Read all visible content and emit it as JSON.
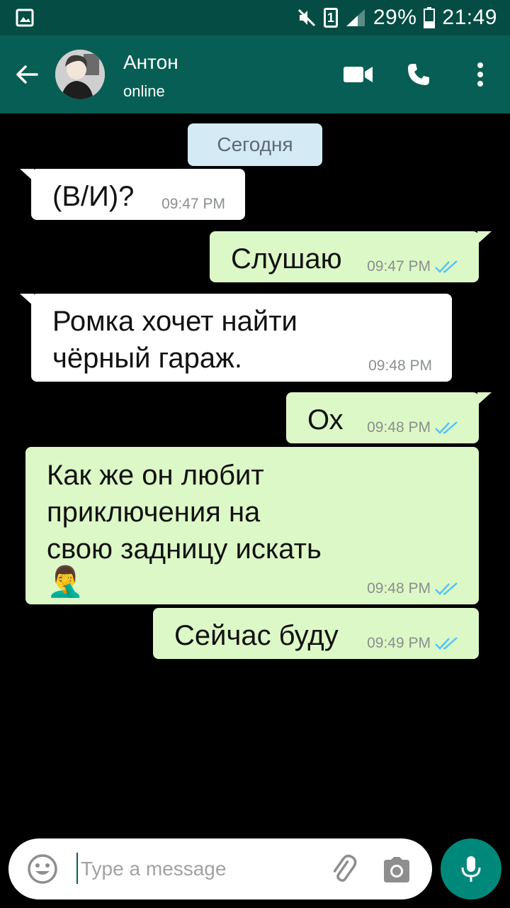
{
  "status_bar": {
    "battery": "29%",
    "time": "21:49",
    "sim_slot": "1",
    "icons": [
      "gallery-icon",
      "mute-icon",
      "sim-icon",
      "signal-icon",
      "battery-icon"
    ]
  },
  "header": {
    "contact_name": "Антон",
    "status": "online",
    "icons": [
      "back-arrow-icon",
      "video-call-icon",
      "phone-icon",
      "more-vert-icon"
    ]
  },
  "chat": {
    "date_label": "Сегодня",
    "messages": [
      {
        "dir": "in",
        "text": "(В/И)?",
        "time": "09:47 PM"
      },
      {
        "dir": "out",
        "text": "Слушаю",
        "time": "09:47 PM",
        "ticks": "read"
      },
      {
        "dir": "in",
        "text": "Ромка хочет найти\nчёрный гараж.",
        "time": "09:48 PM"
      },
      {
        "dir": "out",
        "text": "Ох",
        "time": "09:48 PM",
        "ticks": "read"
      },
      {
        "dir": "out",
        "text": "Как же он любит\nприключения на\nсвою задницу искать",
        "emoji": "🤦‍♂️",
        "time": "09:48 PM",
        "ticks": "read"
      },
      {
        "dir": "out",
        "text": "Сейчас буду",
        "time": "09:49 PM",
        "ticks": "read"
      }
    ]
  },
  "composer": {
    "placeholder": "Type a message",
    "icons": [
      "emoji-icon",
      "attach-icon",
      "camera-icon",
      "mic-icon"
    ]
  },
  "colors": {
    "status_bar": "#054d44",
    "app_bar": "#075e54",
    "incoming_bubble": "#ffffff",
    "outgoing_bubble": "#dcf8c6",
    "date_chip": "#d4eaf4",
    "read_ticks": "#4fc3f7",
    "mic_button": "#00897b"
  }
}
